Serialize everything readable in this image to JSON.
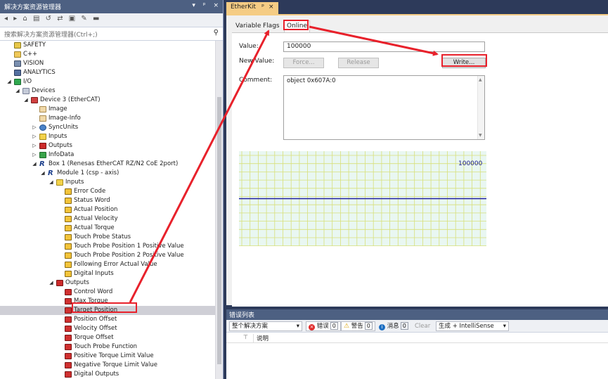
{
  "solution_explorer": {
    "title": "解决方案资源管理器",
    "title_buttons": [
      "▾",
      "ᵖ",
      "×"
    ],
    "search_placeholder": "搜索解决方案资源管理器(Ctrl+;)",
    "tree": [
      {
        "label": "SAFETY",
        "depth": 2,
        "icon": "safety-icon",
        "expand": ""
      },
      {
        "label": "C++",
        "depth": 2,
        "icon": "cpp-icon",
        "expand": ""
      },
      {
        "label": "VISION",
        "depth": 2,
        "icon": "vision-icon",
        "expand": ""
      },
      {
        "label": "ANALYTICS",
        "depth": 2,
        "icon": "analytics-icon",
        "expand": ""
      },
      {
        "label": "I/O",
        "depth": 2,
        "icon": "io-icon",
        "expand": "◢"
      },
      {
        "label": "Devices",
        "depth": 3,
        "icon": "devices-icon",
        "expand": "◢"
      },
      {
        "label": "Device 3 (EtherCAT)",
        "depth": 4,
        "icon": "ethercat-device-icon",
        "expand": "◢"
      },
      {
        "label": "Image",
        "depth": 5,
        "icon": "image-icon",
        "expand": ""
      },
      {
        "label": "Image-Info",
        "depth": 5,
        "icon": "image-icon",
        "expand": ""
      },
      {
        "label": "SyncUnits",
        "depth": 5,
        "icon": "syncunits-icon",
        "expand": "▷"
      },
      {
        "label": "Inputs",
        "depth": 5,
        "icon": "inputs-folder-icon",
        "expand": "▷"
      },
      {
        "label": "Outputs",
        "depth": 5,
        "icon": "outputs-folder-icon",
        "expand": "▷"
      },
      {
        "label": "InfoData",
        "depth": 5,
        "icon": "infodata-icon",
        "expand": "▷"
      },
      {
        "label": "Box 1 (Renesas EtherCAT RZ/N2 CoE 2port)",
        "depth": 5,
        "icon": "box-icon",
        "expand": "◢"
      },
      {
        "label": "Module 1 (csp - axis)",
        "depth": 6,
        "icon": "module-icon",
        "expand": "◢"
      },
      {
        "label": "Inputs",
        "depth": 7,
        "icon": "inputs-folder-icon",
        "expand": "◢"
      },
      {
        "label": "Error Code",
        "depth": 8,
        "icon": "input-var-icon",
        "expand": ""
      },
      {
        "label": "Status Word",
        "depth": 8,
        "icon": "input-var-icon",
        "expand": ""
      },
      {
        "label": "Actual Position",
        "depth": 8,
        "icon": "input-var-icon",
        "expand": ""
      },
      {
        "label": "Actual Velocity",
        "depth": 8,
        "icon": "input-var-icon",
        "expand": ""
      },
      {
        "label": "Actual Torque",
        "depth": 8,
        "icon": "input-var-icon",
        "expand": ""
      },
      {
        "label": "Touch Probe Status",
        "depth": 8,
        "icon": "input-var-icon",
        "expand": ""
      },
      {
        "label": "Touch Probe Position 1 Positive Value",
        "depth": 8,
        "icon": "input-var-icon",
        "expand": ""
      },
      {
        "label": "Touch Probe Position 2 Positive Value",
        "depth": 8,
        "icon": "input-var-icon",
        "expand": ""
      },
      {
        "label": "Following Error Actual Value",
        "depth": 8,
        "icon": "input-var-icon",
        "expand": ""
      },
      {
        "label": "Digital Inputs",
        "depth": 8,
        "icon": "input-var-icon",
        "expand": ""
      },
      {
        "label": "Outputs",
        "depth": 7,
        "icon": "outputs-folder-icon",
        "expand": "◢"
      },
      {
        "label": "Control Word",
        "depth": 8,
        "icon": "output-var-icon",
        "expand": ""
      },
      {
        "label": "Max Torque",
        "depth": 8,
        "icon": "output-var-icon",
        "expand": ""
      },
      {
        "label": "Target Position",
        "depth": 8,
        "icon": "output-var-icon",
        "expand": "",
        "selected": true
      },
      {
        "label": "Position Offset",
        "depth": 8,
        "icon": "output-var-icon",
        "expand": ""
      },
      {
        "label": "Velocity Offset",
        "depth": 8,
        "icon": "output-var-icon",
        "expand": ""
      },
      {
        "label": "Torque Offset",
        "depth": 8,
        "icon": "output-var-icon",
        "expand": ""
      },
      {
        "label": "Touch Probe Function",
        "depth": 8,
        "icon": "output-var-icon",
        "expand": ""
      },
      {
        "label": "Positive Torque Limit Value",
        "depth": 8,
        "icon": "output-var-icon",
        "expand": ""
      },
      {
        "label": "Negative Torque Limit Value",
        "depth": 8,
        "icon": "output-var-icon",
        "expand": ""
      },
      {
        "label": "Digital Outputs",
        "depth": 8,
        "icon": "output-var-icon",
        "expand": ""
      }
    ]
  },
  "etherkit": {
    "tab_title": "EtherKit",
    "tab_pin": "ᵖ",
    "tab_close": "×",
    "subtabs": [
      "Variable",
      "Flags",
      "Online"
    ],
    "active_subtab": "Online",
    "value_label": "Value:",
    "value": "100000",
    "new_value_label": "New Value:",
    "force_button": "Force...",
    "release_button": "Release",
    "write_button": "Write...",
    "comment_label": "Comment:",
    "comment": "object 0x607A:0",
    "chart_label": "100000"
  },
  "chart_data": {
    "type": "line",
    "series": [
      {
        "values": [
          100000,
          100000
        ]
      }
    ],
    "annotation": "100000",
    "grid": true,
    "line_color": "#2020a0",
    "grid_color": "#d8e07a",
    "background": "#e9f7f2"
  },
  "error_list": {
    "title": "错误列表",
    "scope": "整个解决方案",
    "errors_label": "错误",
    "errors_count": "0",
    "warnings_label": "警告",
    "warnings_count": "0",
    "messages_label": "消息",
    "messages_count": "0",
    "clear_button": "Clear",
    "build_filter": "生成 + IntelliSense",
    "column_description": "说明"
  },
  "colors": {
    "annotation_red": "#e8212b",
    "title_bar": "#4d6082",
    "tab_gold": "#f5cc84"
  }
}
